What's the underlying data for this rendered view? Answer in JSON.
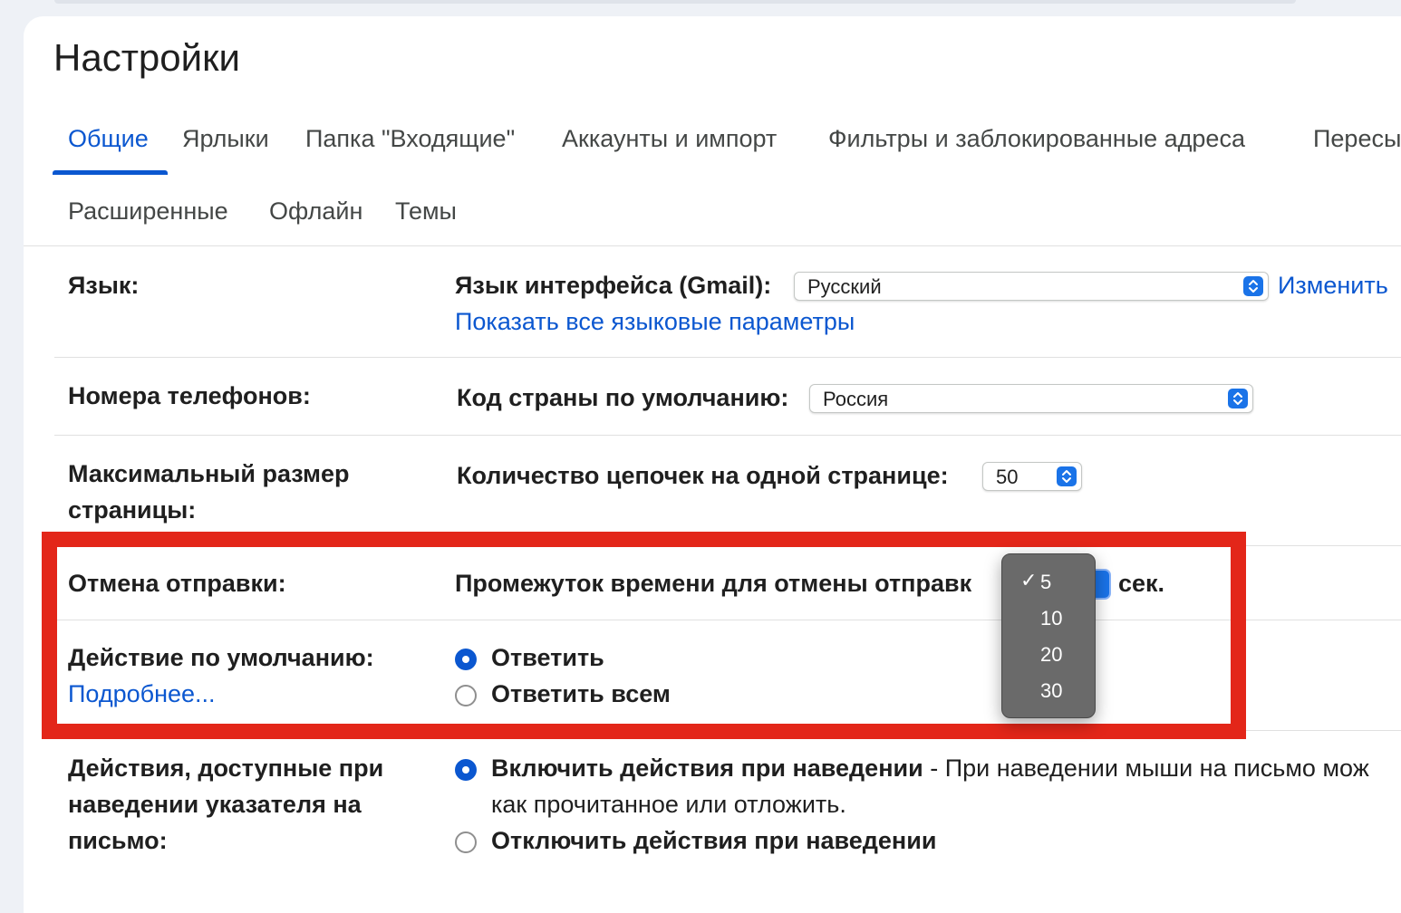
{
  "page": {
    "title": "Настройки"
  },
  "tabs": [
    {
      "label": "Общие",
      "active": true
    },
    {
      "label": "Ярлыки"
    },
    {
      "label": "Папка \"Входящие\""
    },
    {
      "label": "Аккаунты и импорт"
    },
    {
      "label": "Фильтры и заблокированные адреса"
    },
    {
      "label": "Пересы"
    },
    {
      "label": "Расширенные"
    },
    {
      "label": "Офлайн"
    },
    {
      "label": "Темы"
    }
  ],
  "settings": {
    "language": {
      "label": "Язык:",
      "ui_label": "Язык интерфейса (Gmail):",
      "value": "Русский",
      "change_link": "Изменить",
      "show_all_link": "Показать все языковые параметры"
    },
    "phones": {
      "label": "Номера телефонов:",
      "country_label": "Код страны по умолчанию:",
      "value": "Россия"
    },
    "page_size": {
      "label_line1": "Максимальный размер",
      "label_line2": "страницы:",
      "threads_label": "Количество цепочек на одной странице:",
      "value": "50"
    },
    "undo_send": {
      "label": "Отмена отправки:",
      "period_label": "Промежуток времени для отмены отправк",
      "unit": "сек.",
      "options": [
        "5",
        "10",
        "20",
        "30"
      ],
      "selected": "5",
      "check": "✓"
    },
    "default_action": {
      "label": "Действие по умолчанию:",
      "more_link": "Подробнее...",
      "option_reply": "Ответить",
      "option_reply_all": "Ответить всем",
      "selected": "reply"
    },
    "hover_actions": {
      "label_line1": "Действия, доступные при",
      "label_line2": "наведении указателя на",
      "label_line3": "письмо:",
      "enable_label": "Включить действия при наведении",
      "enable_desc_line1": " - При наведении мыши на письмо мож",
      "enable_desc_line2": "как прочитанное или отложить.",
      "disable_label": "Отключить действия при наведении",
      "selected": "enable"
    }
  },
  "colors": {
    "accent": "#0b57d0",
    "highlight_frame": "#e32619",
    "stepper": "#1a73e8",
    "dropdown_bg": "#6a6a6a"
  }
}
